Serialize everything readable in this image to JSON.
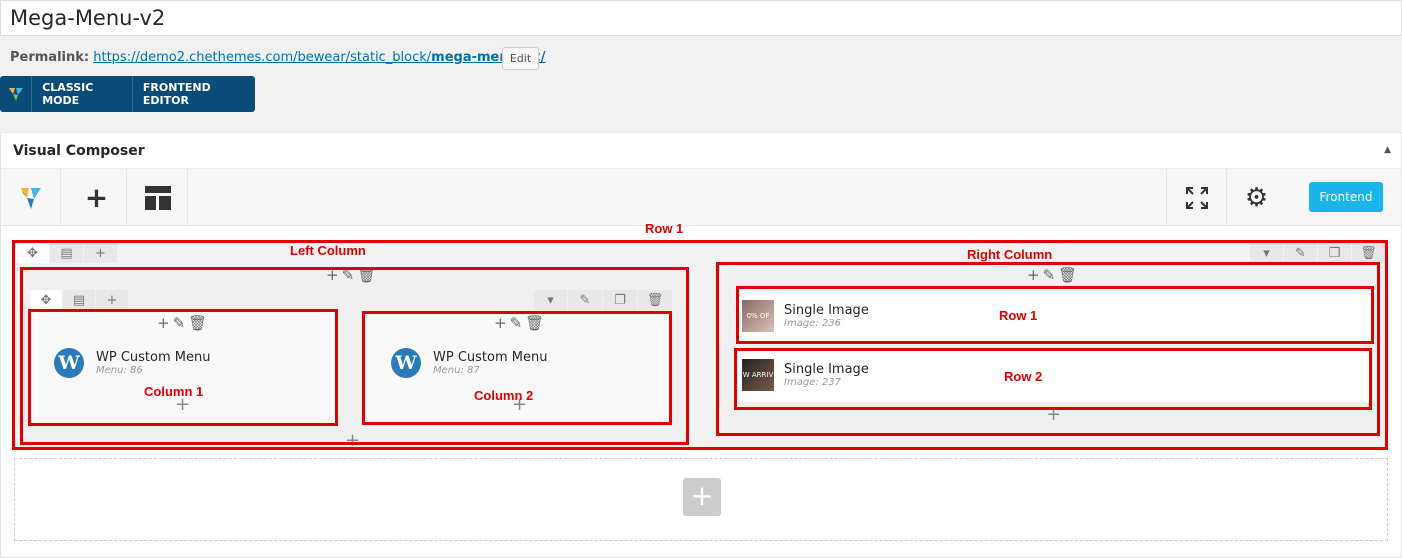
{
  "title": "Mega-Menu-v2",
  "permalink": {
    "label": "Permalink:",
    "url_prefix": "https://demo2.chethemes.com/bewear/static_block/",
    "url_slug": "mega-menu-v2/",
    "edit_label": "Edit"
  },
  "mode_bar": {
    "classic_label": "CLASSIC MODE",
    "frontend_editor_label": "FRONTEND EDITOR"
  },
  "composer": {
    "title": "Visual Composer",
    "frontend_button": "Frontend"
  },
  "left": {
    "col1": {
      "title": "WP Custom Menu",
      "sub": "Menu: 86"
    },
    "col2": {
      "title": "WP Custom Menu",
      "sub": "Menu: 87"
    }
  },
  "right": {
    "img1": {
      "title": "Single Image",
      "sub": "Image: 236",
      "thumb_text": "0% OF"
    },
    "img2": {
      "title": "Single Image",
      "sub": "Image: 237",
      "thumb_text": "W ARRIV"
    }
  },
  "annotations": {
    "row1": "Row 1",
    "left_column": "Left Column",
    "right_column": "Right Column",
    "column1": "Column 1",
    "column2": "Column 2",
    "right_row1": "Row 1",
    "right_row2": "Row 2"
  },
  "colors": {
    "annotation_red": "#e00000",
    "mode_bar_bg": "#0a4b78",
    "frontend_btn": "#1ab4e9"
  }
}
